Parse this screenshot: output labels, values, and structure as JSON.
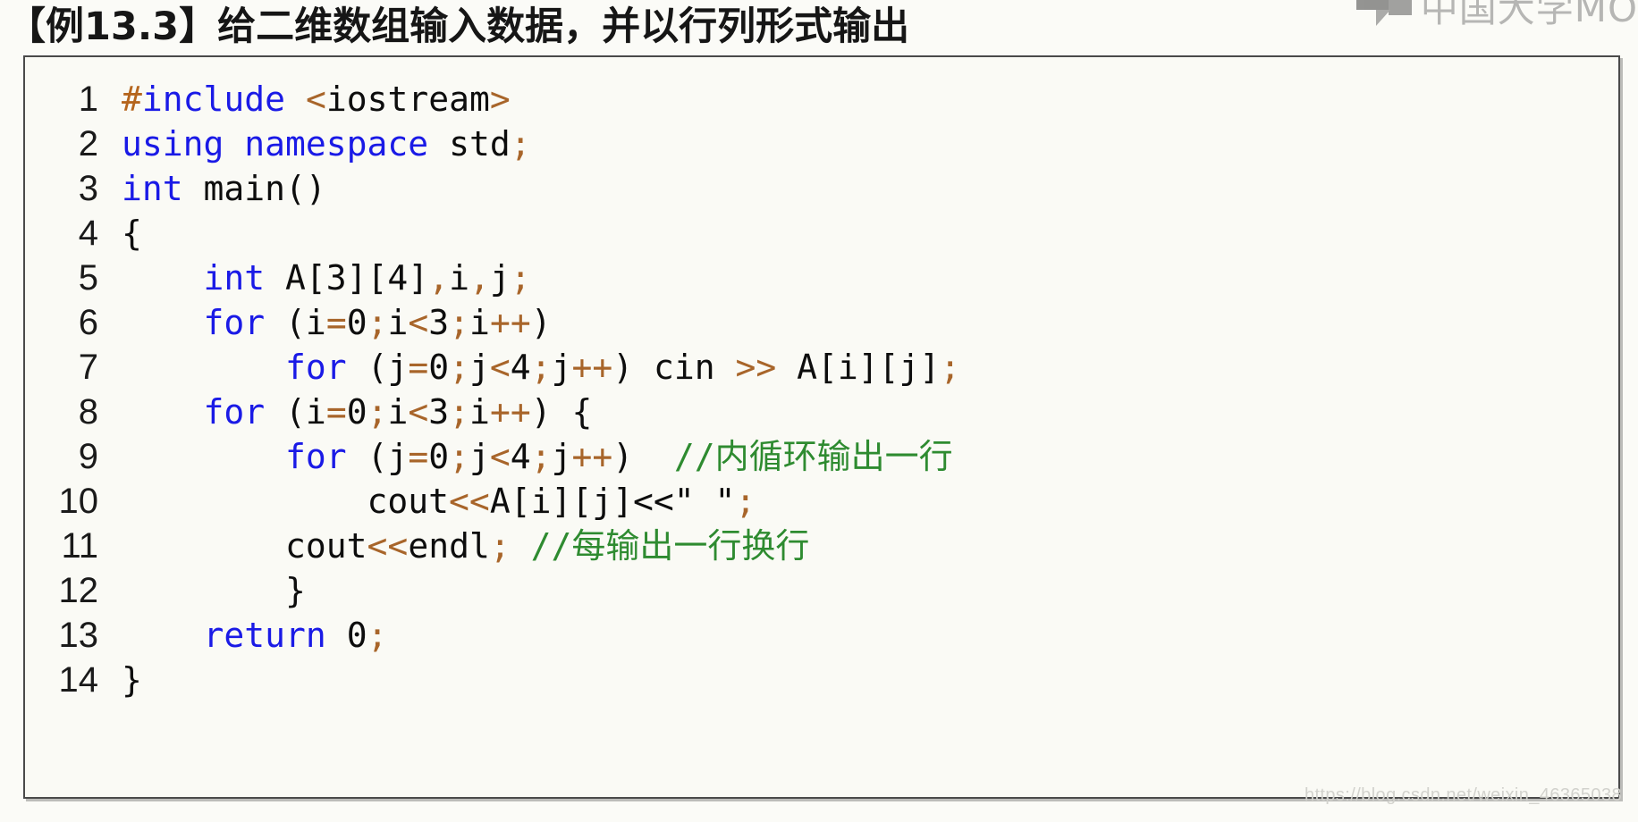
{
  "slide": {
    "title": "【例13.3】给二维数组输入数据，并以行列形式输出"
  },
  "logo": {
    "brand_text": "中国大学MO",
    "mark_name": "mooc-cube-mark"
  },
  "watermark": {
    "url": "https://blog.csdn.net/weixin_46365038"
  },
  "code": {
    "language": "C++",
    "colors": {
      "keyword": "#1a1ae6",
      "preprocessor": "#b5651d",
      "operator": "#a8652a",
      "comment": "#2e8b30",
      "plain": "#0d0d0d",
      "background": "#fafaf5",
      "border": "#4a4a4a"
    },
    "lines": [
      {
        "n": "1",
        "text": "#include <iostream>"
      },
      {
        "n": "2",
        "text": "using namespace std;"
      },
      {
        "n": "3",
        "text": "int main()"
      },
      {
        "n": "4",
        "text": "{"
      },
      {
        "n": "5",
        "text": "    int A[3][4],i,j;"
      },
      {
        "n": "6",
        "text": "    for (i=0;i<3;i++)"
      },
      {
        "n": "7",
        "text": "        for (j=0;j<4;j++) cin >> A[i][j];"
      },
      {
        "n": "8",
        "text": "    for (i=0;i<3;i++) {"
      },
      {
        "n": "9",
        "text": "        for (j=0;j<4;j++)  //内循环输出一行"
      },
      {
        "n": "10",
        "text": "            cout<<A[i][j]<<\" \";"
      },
      {
        "n": "11",
        "text": "        cout<<endl; //每输出一行换行"
      },
      {
        "n": "12",
        "text": "        }"
      },
      {
        "n": "13",
        "text": "    return 0;"
      },
      {
        "n": "14",
        "text": "}"
      }
    ]
  }
}
